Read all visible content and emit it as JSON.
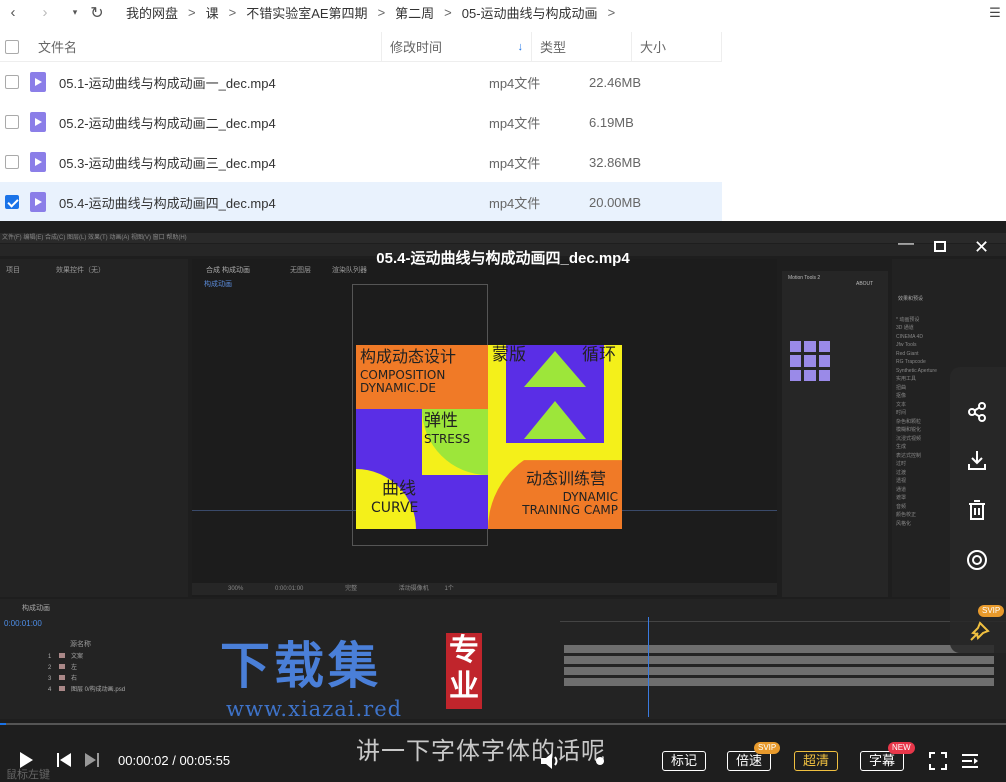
{
  "toolbar": {
    "back_icon": "chevron-left-icon",
    "forward_icon": "chevron-right-icon",
    "breadcrumb": [
      "我的网盘",
      "课",
      "不错实验室AE第四期",
      "第二周",
      "05-运动曲线与构成动画"
    ]
  },
  "table": {
    "headers": {
      "name": "文件名",
      "modified": "修改时间",
      "type": "类型",
      "size": "大小"
    },
    "rows": [
      {
        "name": "05.1-运动曲线与构成动画一_dec.mp4",
        "type": "mp4文件",
        "size": "22.46MB",
        "checked": false
      },
      {
        "name": "05.2-运动曲线与构成动画二_dec.mp4",
        "type": "mp4文件",
        "size": "6.19MB",
        "checked": false
      },
      {
        "name": "05.3-运动曲线与构成动画三_dec.mp4",
        "type": "mp4文件",
        "size": "32.86MB",
        "checked": false
      },
      {
        "name": "05.4-运动曲线与构成动画四_dec.mp4",
        "type": "mp4文件",
        "size": "20.00MB",
        "checked": true
      }
    ]
  },
  "player": {
    "title": "05.4-运动曲线与构成动画四_dec.mp4",
    "time": "00:00:02 / 00:05:55",
    "progress": 0.006,
    "subtitle": "讲一下字体字体的话呢",
    "buttons": {
      "mark": "标记",
      "speed": "倍速",
      "quality": "超清",
      "captions": "字幕"
    },
    "badges": {
      "speed": "SVIP",
      "captions": "NEW",
      "pin": "SVIP"
    },
    "hint": "鼠标左键",
    "accent": "#1a73e8"
  },
  "ae": {
    "menu": "文件(F)  编辑(E)  合成(C)  图层(L)  效果(T)  动画(A)  视图(V)  窗口  帮助(H)",
    "panel_project": "项目",
    "panel_effects_ctrl": "效果控件（无）",
    "comp_tabs": [
      "合成 构成动画",
      "无图层",
      "渲染队列器"
    ],
    "comp_sub": "构成动画",
    "comp_zoom": "300%",
    "comp_time": "0:00:01:00",
    "comp_view": "完整",
    "comp_camera": "活动摄像机",
    "comp_views": "1个",
    "timeline_tab": "构成动画",
    "timecode": "0:00:01:00",
    "layer_header": "源名称",
    "layers": [
      {
        "num": "1",
        "name": "文案"
      },
      {
        "num": "2",
        "name": "左"
      },
      {
        "num": "3",
        "name": "右"
      },
      {
        "num": "4",
        "name": "图层 0/构成动画.psd"
      }
    ],
    "effects_title": "效果和预设",
    "effects_list": [
      "* 动画预设",
      "3D 通道",
      "CINEMA 4D",
      "Jfw Tools",
      "Red Giant",
      "RG Trapcode",
      "Synthetic Aperture",
      "实用工具",
      "扭曲",
      "抠像",
      "文本",
      "时间",
      "杂色和颗粒",
      "模糊和锐化",
      "沉浸式视频",
      "生成",
      "表达式控制",
      "过时",
      "过渡",
      "透视",
      "通道",
      "遮罩",
      "音频",
      "颜色校正",
      "风格化"
    ],
    "motion_tools": "Motion Tools 2",
    "about": "ABOUT"
  },
  "artwork": {
    "t1_cn": "构成动态设计",
    "t1_en": "COMPOSITION\nDYNAMIC.DE",
    "t2": "蒙版",
    "t3": "循环",
    "t4_cn": "弹性",
    "t4_en": "STRESS",
    "t5_cn": "曲线",
    "t5_en": "CURVE",
    "t6_cn": "动态训练营",
    "t6_en": "DYNAMIC\nTRAINING CAMP"
  },
  "watermark": {
    "text": "下载集",
    "url": "www.xiazai.red",
    "seal": "专业"
  },
  "sidebar_icons": [
    "share-icon",
    "download-icon",
    "delete-icon",
    "target-icon",
    "pin-icon"
  ]
}
